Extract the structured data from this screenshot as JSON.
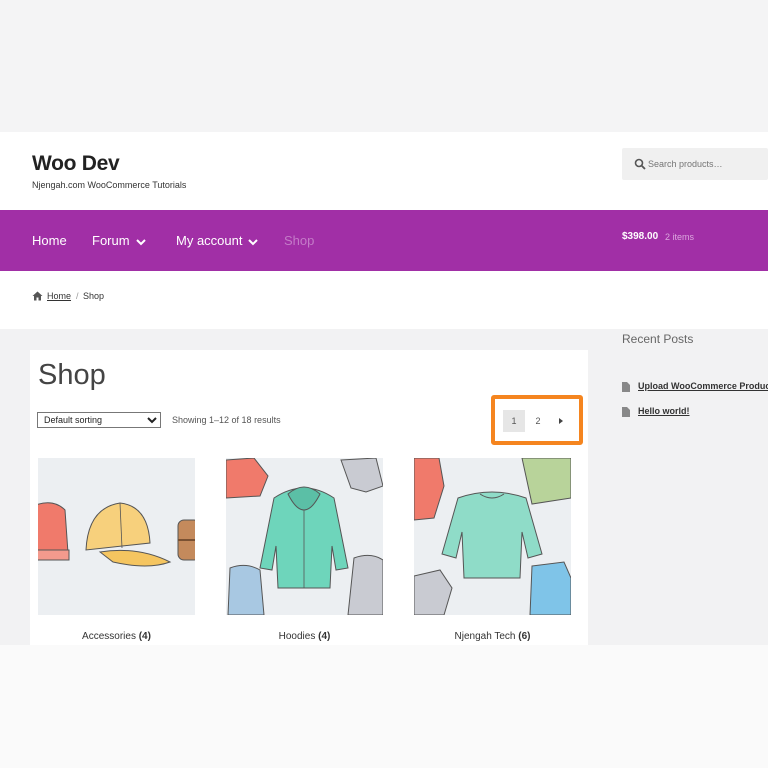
{
  "site": {
    "title": "Woo Dev",
    "tagline": "Njengah.com WooCommerce Tutorials"
  },
  "search": {
    "placeholder": "Search products…"
  },
  "nav": {
    "items": [
      {
        "label": "Home"
      },
      {
        "label": "Forum",
        "dropdown": true
      },
      {
        "label": "My account",
        "dropdown": true
      },
      {
        "label": "Shop"
      }
    ],
    "bar_color": "#a12fa6"
  },
  "cart": {
    "amount": "$398.00",
    "count": "2 items"
  },
  "breadcrumb": {
    "home": "Home",
    "separator": "/",
    "current": "Shop"
  },
  "main": {
    "title": "Shop",
    "sorting": {
      "selected": "Default sorting"
    },
    "result_count": "Showing 1–12 of 18 results",
    "pagination": {
      "pages": [
        "1",
        "2"
      ],
      "current": "1",
      "highlight_color": "#f5851f"
    },
    "products": [
      {
        "name": "Accessories",
        "count": "(4)"
      },
      {
        "name": "Hoodies",
        "count": "(4)"
      },
      {
        "name": "Njengah Tech",
        "count": "(6)"
      }
    ]
  },
  "sidebar": {
    "title": "Recent Posts",
    "posts": [
      "Upload WooCommerce Product",
      "Hello world!"
    ]
  }
}
